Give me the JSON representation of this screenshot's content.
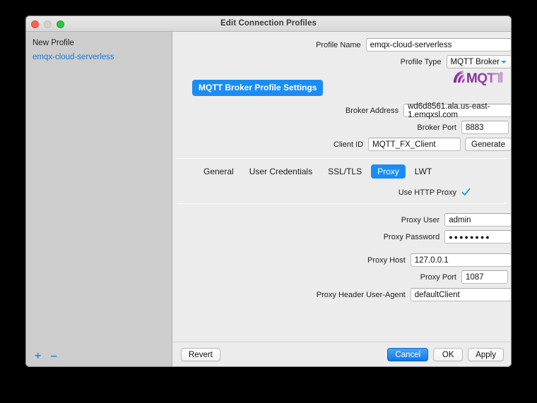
{
  "window": {
    "title": "Edit Connection Profiles",
    "traffic_lights": [
      "close",
      "minimize",
      "zoom"
    ]
  },
  "sidebar": {
    "items": [
      {
        "label": "New Profile",
        "selected": false,
        "style": "plain"
      },
      {
        "label": "emqx-cloud-serverless",
        "selected": true,
        "style": "link"
      }
    ],
    "footer": {
      "add_label": "+",
      "remove_label": "–"
    }
  },
  "header": {
    "profile_name_label": "Profile Name",
    "profile_name_value": "emqx-cloud-serverless",
    "profile_type_label": "Profile Type",
    "profile_type_value": "MQTT Broker",
    "logo_text": "MQTT"
  },
  "section": {
    "title": "MQTT Broker Profile Settings",
    "fields": [
      {
        "label": "Broker Address",
        "value": "wd6d8561.ala.us-east-1.emqxsl.com"
      },
      {
        "label": "Broker Port",
        "value": "8883"
      },
      {
        "label": "Client ID",
        "value": "MQTT_FX_Client"
      }
    ],
    "generate_label": "Generate"
  },
  "tabs": [
    {
      "label": "General",
      "active": false
    },
    {
      "label": "User Credentials",
      "active": false
    },
    {
      "label": "SSL/TLS",
      "active": false
    },
    {
      "label": "Proxy",
      "active": true
    },
    {
      "label": "LWT",
      "active": false
    }
  ],
  "proxy": {
    "use_http_proxy_label": "Use HTTP Proxy",
    "use_http_proxy_checked": true,
    "fields": [
      {
        "label": "Proxy User",
        "value": "admin",
        "type": "text"
      },
      {
        "label": "Proxy Password",
        "value": "●●●●●●●●",
        "type": "password"
      },
      {
        "label": "Proxy Host",
        "value": "127.0.0.1",
        "type": "text"
      },
      {
        "label": "Proxy Port",
        "value": "1087",
        "type": "text"
      },
      {
        "label": "Proxy Header User-Agent",
        "value": "defaultClient",
        "type": "text"
      }
    ]
  },
  "footer": {
    "revert_label": "Revert",
    "cancel_label": "Cancel",
    "ok_label": "OK",
    "apply_label": "Apply"
  },
  "colors": {
    "accent": "#1a8cf5",
    "link": "#1878d6",
    "window_bg": "#ececec",
    "sidebar_bg": "#cdcdcd",
    "logo_purple": "#8e2f9e",
    "check_blue": "#2f9ae8"
  }
}
